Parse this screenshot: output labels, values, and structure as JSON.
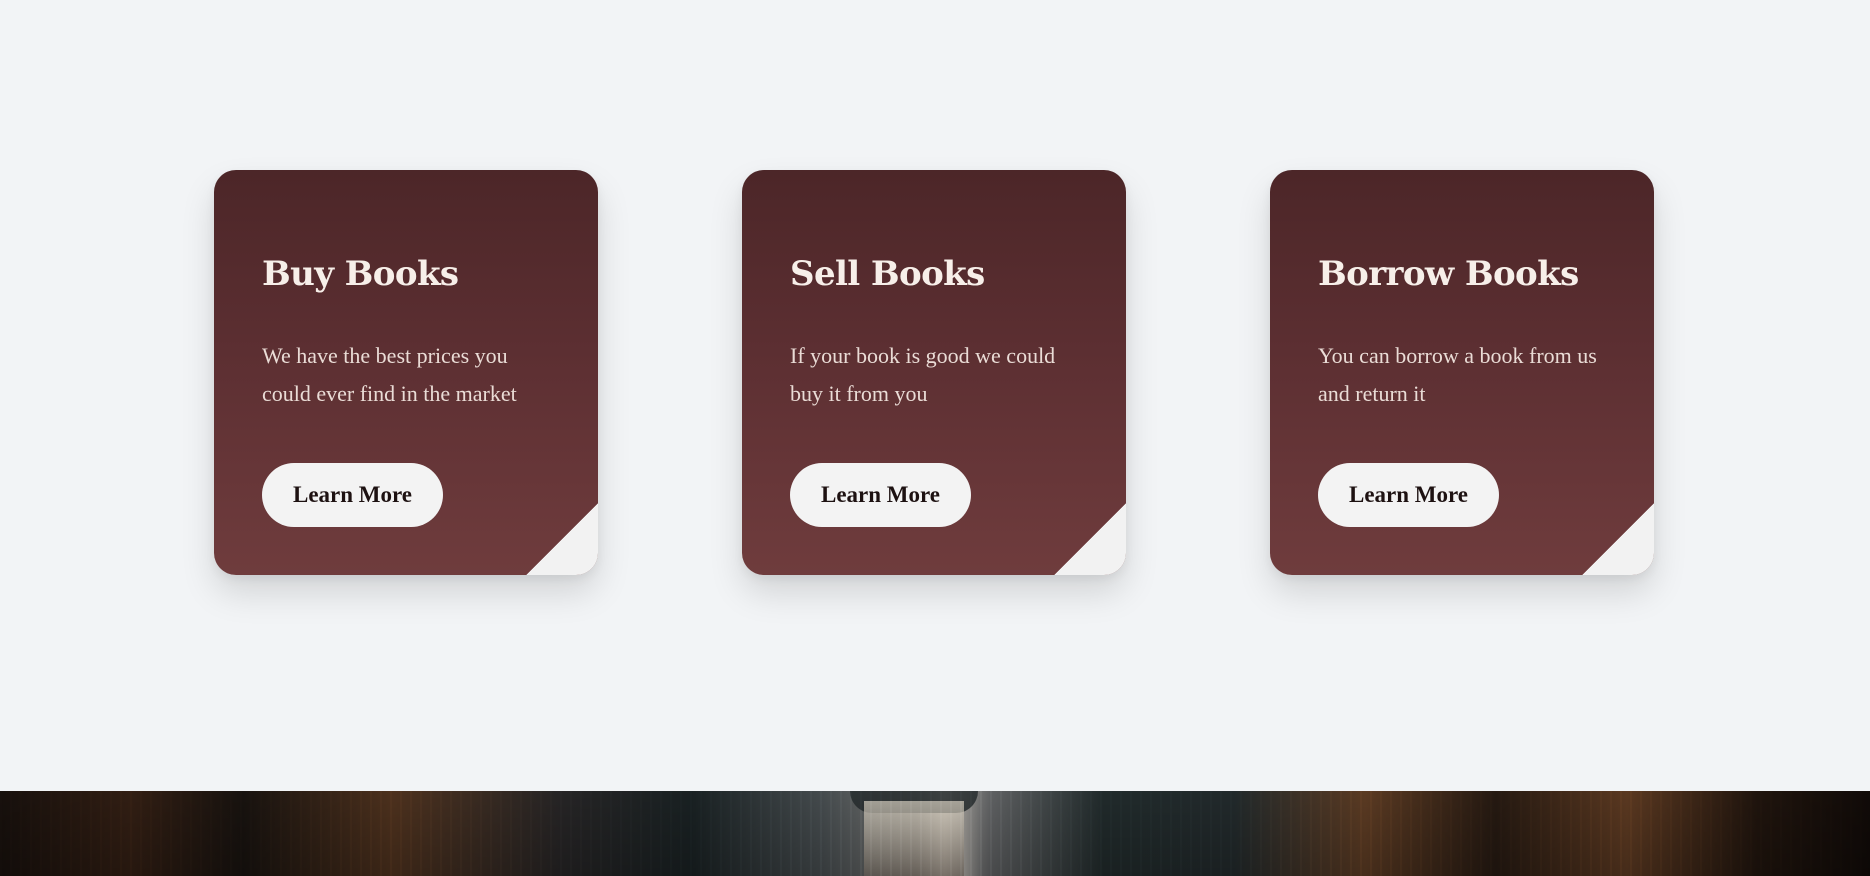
{
  "services": {
    "cards": [
      {
        "title": "Buy Books",
        "description": "We have the best prices you could ever find in the market",
        "button_label": "Learn More"
      },
      {
        "title": "Sell Books",
        "description": "If your book is good we could buy it from you",
        "button_label": "Learn More"
      },
      {
        "title": "Borrow Books",
        "description": "You can borrow a book from us and return it",
        "button_label": "Learn More"
      }
    ]
  },
  "colors": {
    "card_gradient_top": "#4c2628",
    "card_gradient_bottom": "#6f3c3d",
    "page_background": "#f2f4f6",
    "button_background": "#f3f3f3"
  },
  "footer_image": {
    "icon": "library-photo"
  }
}
